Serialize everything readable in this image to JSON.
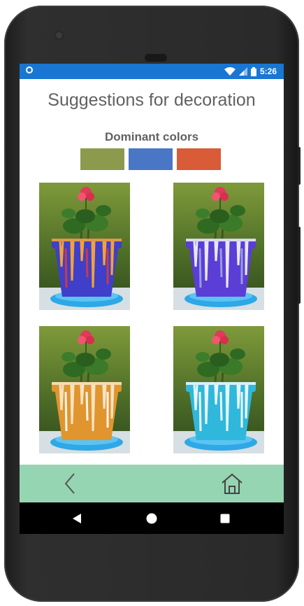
{
  "status_bar": {
    "time": "5:26",
    "background": "#1976d2"
  },
  "page": {
    "title": "Suggestions for decoration"
  },
  "dominant_colors": {
    "label": "Dominant colors",
    "swatches": [
      "#8c9a4e",
      "#4a77c5",
      "#d95b37"
    ]
  },
  "suggestions": [
    {
      "pot_color": "#3f3fc9",
      "drip_color": "#f2a23a",
      "drip2": "#d93a3a"
    },
    {
      "pot_color": "#5a3ed6",
      "drip_color": "#e8e8f5",
      "drip2": "#9fa3e0"
    },
    {
      "pot_color": "#e0952e",
      "drip_color": "#f7e3c0",
      "drip2": "#ffffff"
    },
    {
      "pot_color": "#2fb8dc",
      "drip_color": "#e7f7fc",
      "drip2": "#ffffff"
    }
  ],
  "nav_bar": {
    "background": "#95d5b2",
    "back_icon": "chevron-left-icon",
    "home_icon": "home-icon"
  },
  "system_nav": {
    "back_icon": "triangle-back-icon",
    "home_icon": "circle-home-icon",
    "recents_icon": "square-recents-icon"
  }
}
